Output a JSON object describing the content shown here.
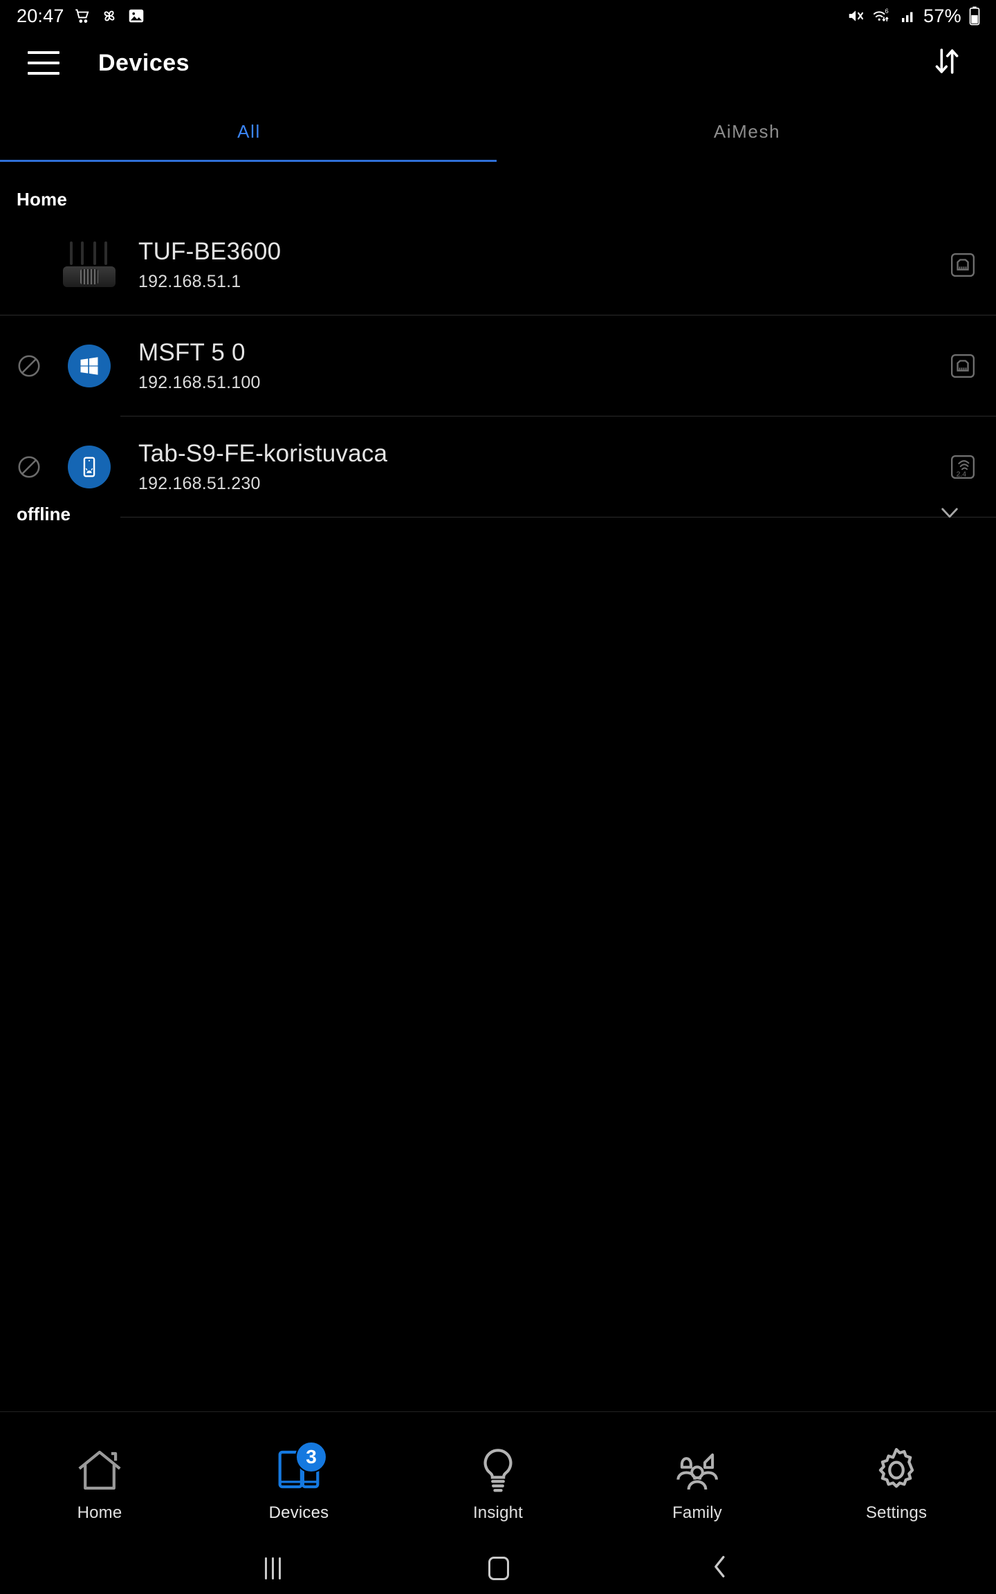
{
  "statusbar": {
    "time": "20:47",
    "left_icons": [
      "shopping-cart-icon",
      "pinwheel-icon",
      "image-icon"
    ],
    "right_icons": [
      "mute-icon",
      "wifi-6-icon",
      "cellular-signal-icon",
      "battery-icon"
    ],
    "battery_percent": "57%"
  },
  "appbar": {
    "menu_icon": "hamburger-menu-icon",
    "title": "Devices",
    "sort_icon": "sort-arrows-icon"
  },
  "tabs": [
    {
      "label": "All",
      "active": true
    },
    {
      "label": "AiMesh",
      "active": false
    }
  ],
  "groups": [
    {
      "label": "Home",
      "devices": [
        {
          "name": "TUF-BE3600",
          "ip": "192.168.51.1",
          "avatar": "router-image",
          "blocked": false,
          "connection": "ethernet-icon",
          "connection_label": "",
          "divider": "full"
        },
        {
          "name": "MSFT 5 0",
          "ip": "192.168.51.100",
          "avatar": "windows-logo-icon",
          "blocked": true,
          "block_icon": "block-icon",
          "connection": "ethernet-icon",
          "connection_label": "",
          "divider": "inset"
        },
        {
          "name": "Tab-S9-FE-koristuvaca",
          "ip": "192.168.51.230",
          "avatar": "android-tablet-icon",
          "blocked": true,
          "block_icon": "block-icon",
          "connection": "wifi-band-icon",
          "connection_label": "2.4",
          "divider": "inset"
        }
      ]
    }
  ],
  "offline_section": {
    "label": "offline",
    "expander_icon": "chevron-down-icon"
  },
  "bottom_nav": [
    {
      "label": "Home",
      "icon": "home-icon",
      "active": false,
      "badge": ""
    },
    {
      "label": "Devices",
      "icon": "devices-icon",
      "active": true,
      "badge": "3"
    },
    {
      "label": "Insight",
      "icon": "lightbulb-icon",
      "active": false,
      "badge": ""
    },
    {
      "label": "Family",
      "icon": "family-icon",
      "active": false,
      "badge": ""
    },
    {
      "label": "Settings",
      "icon": "gear-icon",
      "active": false,
      "badge": ""
    }
  ],
  "android_nav": {
    "recents": "recents-icon",
    "home": "home-square-icon",
    "back": "back-chevron-icon"
  },
  "colors": {
    "accent_blue": "#3b85f5",
    "badge_blue": "#1579e0",
    "avatar_blue": "#1566b4",
    "background": "#000000",
    "divider": "#2b2b2b",
    "inactive_tab": "#8d8d8d"
  }
}
